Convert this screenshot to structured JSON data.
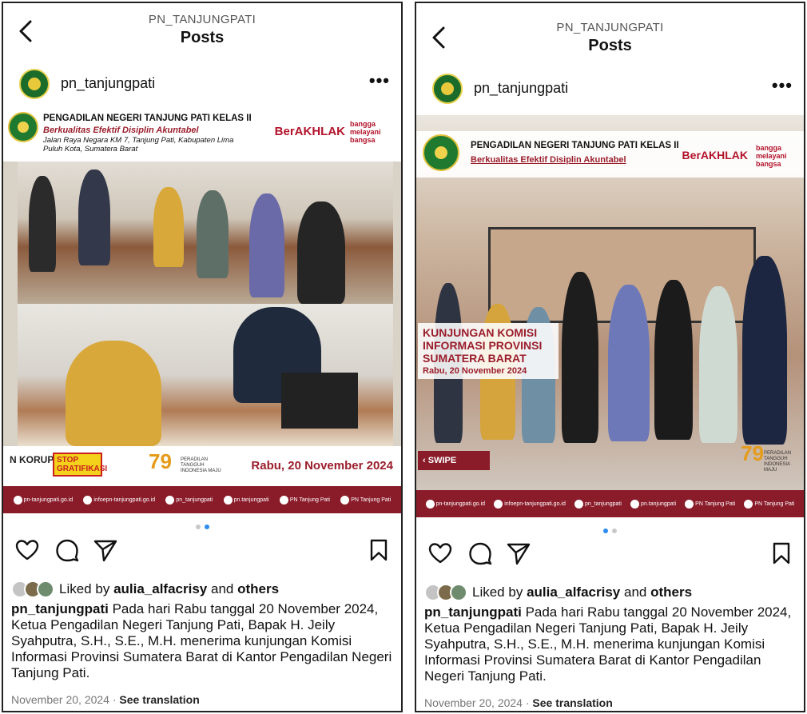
{
  "posts": [
    {
      "header_subtitle": "PN_TANJUNGPATI",
      "header_title": "Posts",
      "username": "pn_tanjungpati",
      "more_label": "•••",
      "image": {
        "org": "PENGADILAN NEGERI TANJUNG PATI KELAS II",
        "motto": "Berkualitas Efektif Disiplin Akuntabel",
        "address": "Jalan Raya Negara KM 7, Tanjung Pati, Kabupaten Lima Puluh Kota, Sumatera Barat",
        "berakhlak": "BerAKHLAK",
        "bangga": "bangga melayani bangsa",
        "korupsi": "N KORUPSI",
        "stop": "STOP GRATIFIKASI",
        "peradilan": "PERADILAN TANGGUH INDONESIA MAJU",
        "date": "Rabu, 20 November 2024",
        "footer": [
          "pn-tanjungpati.go.id",
          "infoepn-tanjungpati.go.id",
          "pn_tanjungpati",
          "pn.tanjungpati",
          "PN Tanjung Pati",
          "PN Tanjung Pati"
        ]
      },
      "active_dot": 1,
      "liked_by_prefix": "Liked by",
      "liked_by_user": "aulia_alfacrisy",
      "liked_by_and": "and",
      "liked_by_others": "others",
      "caption_user": "pn_tanjungpati",
      "caption_text": "Pada hari Rabu tanggal 20 November 2024, Ketua Pengadilan Negeri Tanjung Pati, Bapak H. Jeily Syahputra, S.H., S.E., M.H. menerima kunjungan Komisi Informasi Provinsi Sumatera Barat di Kantor Pengadilan Negeri Tanjung Pati.",
      "date": "November 20, 2024",
      "date_sep": "·",
      "see_translation": "See translation"
    },
    {
      "header_subtitle": "PN_TANJUNGPATI",
      "header_title": "Posts",
      "username": "pn_tanjungpati",
      "more_label": "•••",
      "image": {
        "org": "PENGADILAN NEGERI TANJUNG PATI KELAS II",
        "motto": "Berkualitas Efektif Disiplin Akuntabel",
        "berakhlak": "BerAKHLAK",
        "bangga": "bangga melayani bangsa",
        "kunjungan": "KUNJUNGAN KOMISI INFORMASI PROVINSI SUMATERA BARAT",
        "date": "Rabu, 20 November 2024",
        "swipe": "SWIPE",
        "peradilan": "PERADILAN TANGGUH INDONESIA MAJU",
        "footer": [
          "pn-tanjungpati.go.id",
          "infoepn-tanjungpati.go.id",
          "pn_tanjungpati",
          "pn.tanjungpati",
          "PN Tanjung Pati",
          "PN Tanjung Pati"
        ]
      },
      "active_dot": 0,
      "liked_by_prefix": "Liked by",
      "liked_by_user": "aulia_alfacrisy",
      "liked_by_and": "and",
      "liked_by_others": "others",
      "caption_user": "pn_tanjungpati",
      "caption_text": "Pada hari Rabu tanggal 20 November 2024, Ketua Pengadilan Negeri Tanjung Pati, Bapak H. Jeily Syahputra, S.H., S.E., M.H. menerima kunjungan Komisi Informasi Provinsi Sumatera Barat di Kantor Pengadilan Negeri Tanjung Pati.",
      "date": "November 20, 2024",
      "date_sep": "·",
      "see_translation": "See translation"
    }
  ],
  "icons": {
    "back": "chevron-left-icon",
    "like": "heart-icon",
    "comment": "comment-icon",
    "share": "send-icon",
    "save": "bookmark-icon"
  },
  "colors": {
    "accent_blue": "#2d8cf0",
    "brand_maroon": "#8a1c2a"
  }
}
